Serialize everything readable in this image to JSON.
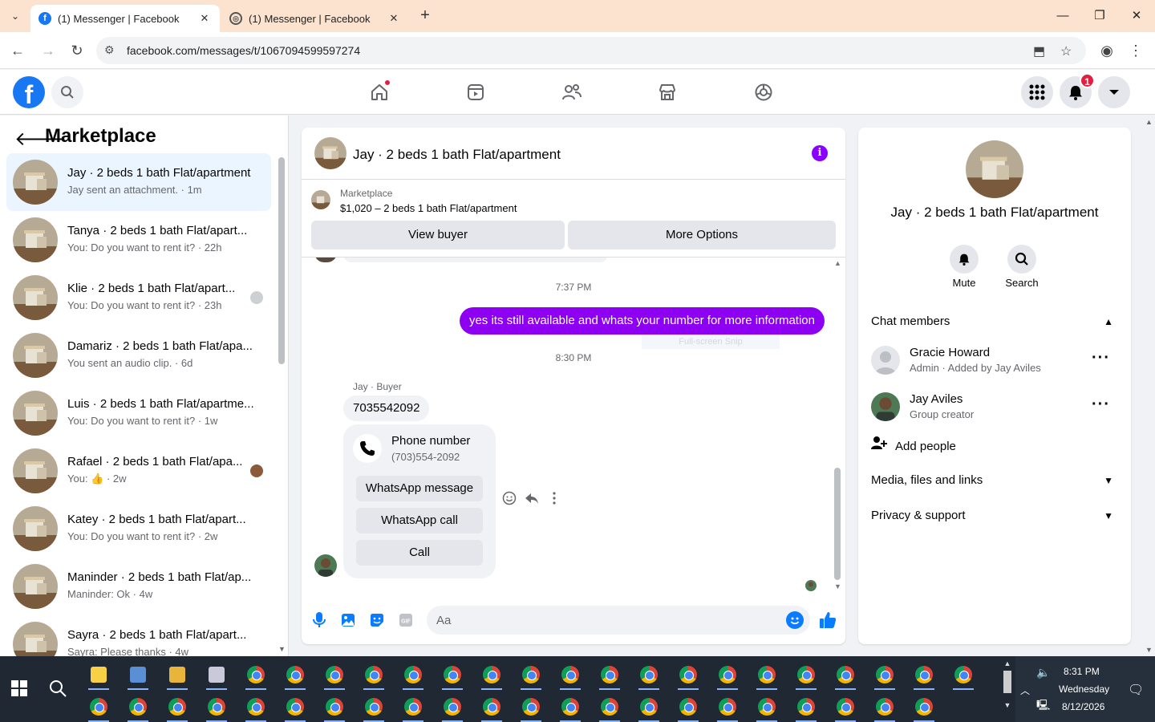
{
  "browser": {
    "tabs": [
      {
        "title": "(1) Messenger | Facebook",
        "active": true
      },
      {
        "title": "(1) Messenger | Facebook",
        "active": false
      }
    ],
    "url": "facebook.com/messages/t/1067094599597274"
  },
  "header": {
    "notifications_badge": "1"
  },
  "sidebar": {
    "title": "Marketplace",
    "conversations": [
      {
        "name": "Jay · 2 beds 1 bath Flat/apartment",
        "preview": "Jay sent an attachment. · 1m",
        "active": true
      },
      {
        "name": "Tanya · 2 beds 1 bath Flat/apart...",
        "preview": "You: Do you want to rent it? · 22h"
      },
      {
        "name": "Klie · 2 beds 1 bath Flat/apart...",
        "preview": "You: Do you want to rent it? · 23h"
      },
      {
        "name": "Damariz · 2 beds 1 bath Flat/apa...",
        "preview": "You sent an audio clip. · 6d"
      },
      {
        "name": "Luis · 2 beds 1 bath Flat/apartme...",
        "preview": "You: Do you want to rent it? · 1w"
      },
      {
        "name": "Rafael · 2 beds 1 bath Flat/apa...",
        "preview": "You: 👍 · 2w"
      },
      {
        "name": "Katey · 2 beds 1 bath Flat/apart...",
        "preview": "You: Do you want to rent it? · 2w"
      },
      {
        "name": "Maninder · 2 beds 1 bath Flat/ap...",
        "preview": "Maninder: Ok · 4w"
      },
      {
        "name": "Sayra · 2 beds 1 bath Flat/apart...",
        "preview": "Sayra: Please thanks · 4w"
      }
    ]
  },
  "chat": {
    "title": "Jay · 2 beds 1 bath Flat/apartment",
    "listing": {
      "label": "Marketplace",
      "title": "$1,020 – 2 beds 1 bath Flat/apartment",
      "view_buyer": "View buyer",
      "more_options": "More Options"
    },
    "timestamp1": "7:37 PM",
    "outgoing": "yes its still available and whats your number for more information",
    "snip_overlay": "Full-screen Snip",
    "timestamp2": "8:30 PM",
    "sender_label": "Jay · Buyer",
    "incoming": "7035542092",
    "phone_card": {
      "title": "Phone number",
      "number": "(703)554-2092",
      "whatsapp_message": "WhatsApp message",
      "whatsapp_call": "WhatsApp call",
      "call": "Call"
    },
    "composer_placeholder": "Aa"
  },
  "details": {
    "title": "Jay · 2 beds 1 bath Flat/apartment",
    "mute": "Mute",
    "search": "Search",
    "chat_members": "Chat members",
    "members": [
      {
        "name": "Gracie Howard",
        "sub": "Admin · Added by Jay Aviles"
      },
      {
        "name": "Jay Aviles",
        "sub": "Group creator"
      }
    ],
    "add_people": "Add people",
    "media": "Media, files and links",
    "privacy": "Privacy & support"
  },
  "taskbar": {
    "time": "8:31 PM",
    "day": "Wednesday",
    "date": "8/12/2026"
  },
  "colors": {
    "facebook_blue": "#1877f2",
    "messenger_purple": "#8d00f2",
    "active_conv": "#ebf5ff"
  }
}
